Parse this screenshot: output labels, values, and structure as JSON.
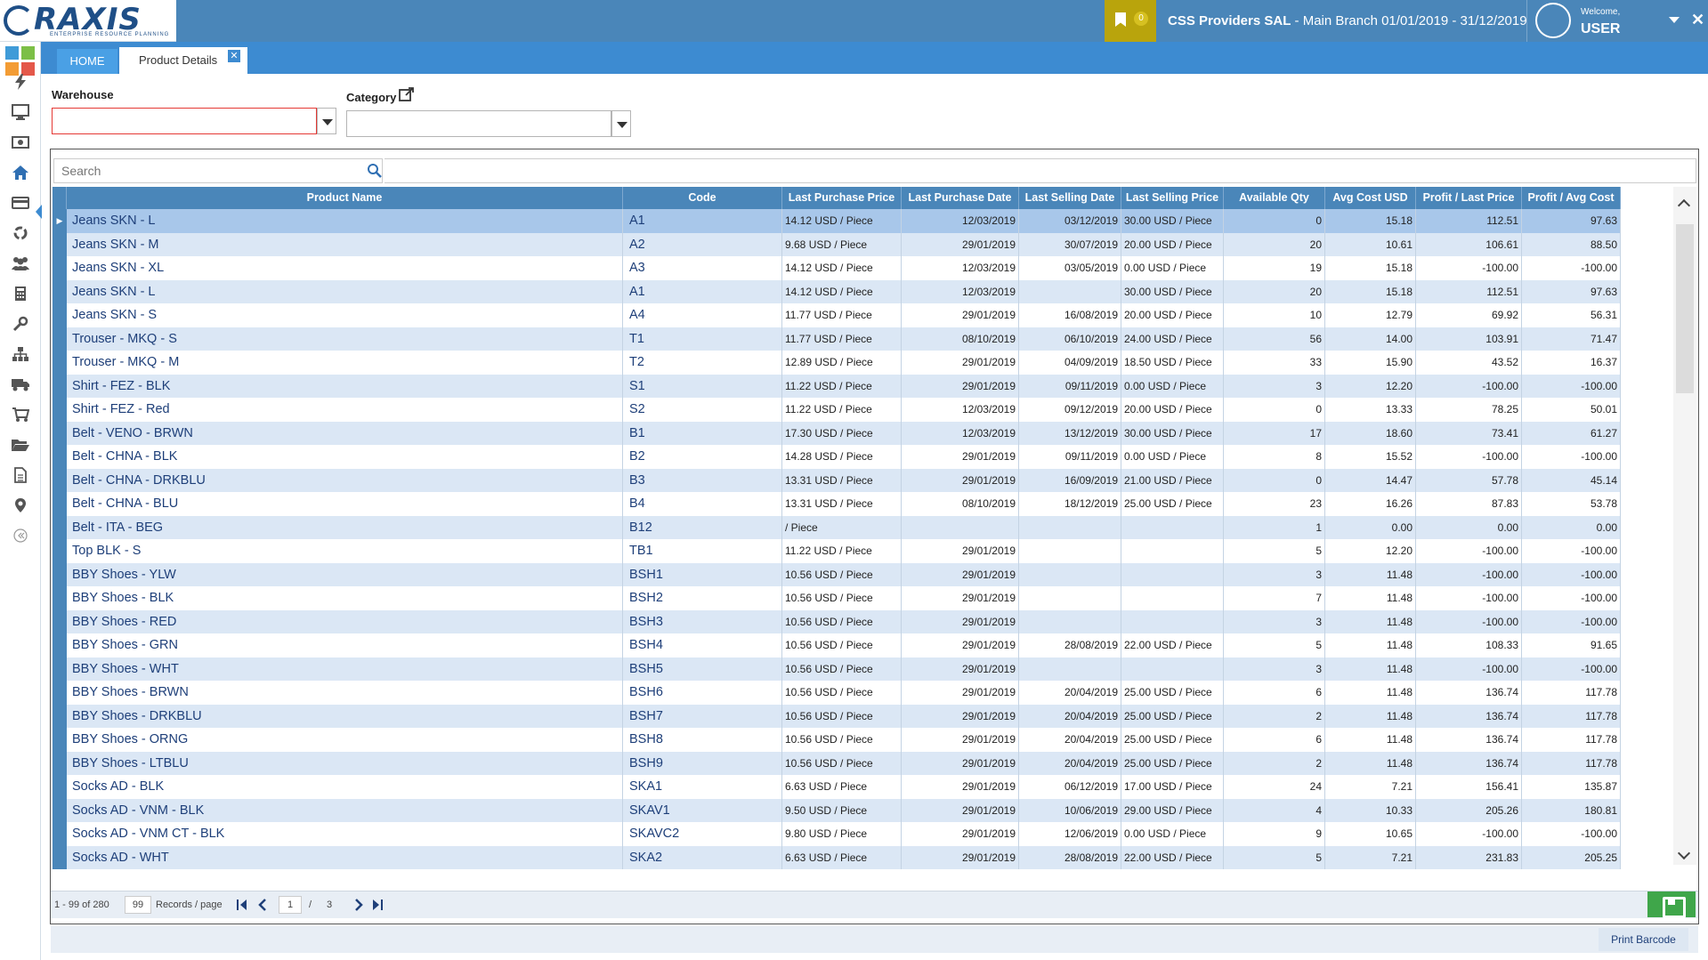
{
  "header": {
    "logo_text": "RAXIS",
    "logo_subtitle": "ENTERPRISE RESOURCE PLANNING",
    "bookmark_count": "0",
    "company_name": "CSS Providers SAL",
    "company_branch": " - Main Branch 01/01/2019 - 31/12/2019",
    "welcome_label": "Welcome,",
    "user_name": "USER",
    "close_glyph": "✕"
  },
  "tabs": {
    "home_label": "HOME",
    "active_label": "Product Details",
    "close_glyph": "✕"
  },
  "filters": {
    "warehouse_label": "Warehouse",
    "warehouse_value": "",
    "category_label": "Category",
    "category_value": ""
  },
  "search": {
    "placeholder": "Search"
  },
  "grid": {
    "columns": [
      "Product Name",
      "Code",
      "Last Purchase Price",
      "Last Purchase Date",
      "Last Selling Date",
      "Last Selling Price",
      "Available Qty",
      "Avg Cost USD",
      "Profit / Last Price",
      "Profit / Avg Cost"
    ],
    "selected_indicator": "▶",
    "rows": [
      [
        "Jeans SKN - L",
        "A1",
        "14.12 USD / Piece",
        "12/03/2019",
        "03/12/2019",
        "30.00 USD / Piece",
        "0",
        "15.18",
        "112.51",
        "97.63"
      ],
      [
        "Jeans SKN  - M",
        "A2",
        "9.68 USD / Piece",
        "29/01/2019",
        "30/07/2019",
        "20.00 USD / Piece",
        "20",
        "10.61",
        "106.61",
        "88.50"
      ],
      [
        "Jeans SKN - XL",
        "A3",
        "14.12 USD / Piece",
        "12/03/2019",
        "03/05/2019",
        "0.00 USD / Piece",
        "19",
        "15.18",
        "-100.00",
        "-100.00"
      ],
      [
        "Jeans SKN - L",
        "A1",
        "14.12 USD / Piece",
        "12/03/2019",
        "",
        "30.00 USD / Piece",
        "20",
        "15.18",
        "112.51",
        "97.63"
      ],
      [
        "Jeans SKN - S",
        "A4",
        "11.77 USD / Piece",
        "29/01/2019",
        "16/08/2019",
        "20.00 USD / Piece",
        "10",
        "12.79",
        "69.92",
        "56.31"
      ],
      [
        "Trouser - MKQ - S",
        "T1",
        "11.77 USD / Piece",
        "08/10/2019",
        "06/10/2019",
        "24.00 USD / Piece",
        "56",
        "14.00",
        "103.91",
        "71.47"
      ],
      [
        "Trouser - MKQ - M",
        "T2",
        "12.89 USD / Piece",
        "29/01/2019",
        "04/09/2019",
        "18.50 USD / Piece",
        "33",
        "15.90",
        "43.52",
        "16.37"
      ],
      [
        "Shirt - FEZ - BLK",
        "S1",
        "11.22 USD / Piece",
        "29/01/2019",
        "09/11/2019",
        "0.00 USD / Piece",
        "3",
        "12.20",
        "-100.00",
        "-100.00"
      ],
      [
        "Shirt - FEZ - Red",
        "S2",
        "11.22 USD / Piece",
        "12/03/2019",
        "09/12/2019",
        "20.00 USD / Piece",
        "0",
        "13.33",
        "78.25",
        "50.01"
      ],
      [
        "Belt - VENO - BRWN",
        "B1",
        "17.30 USD / Piece",
        "12/03/2019",
        "13/12/2019",
        "30.00 USD / Piece",
        "17",
        "18.60",
        "73.41",
        "61.27"
      ],
      [
        "Belt - CHNA - BLK",
        "B2",
        "14.28 USD / Piece",
        "29/01/2019",
        "09/11/2019",
        "0.00 USD / Piece",
        "8",
        "15.52",
        "-100.00",
        "-100.00"
      ],
      [
        "Belt - CHNA - DRKBLU",
        "B3",
        "13.31 USD / Piece",
        "29/01/2019",
        "16/09/2019",
        "21.00 USD / Piece",
        "0",
        "14.47",
        "57.78",
        "45.14"
      ],
      [
        "Belt - CHNA - BLU",
        "B4",
        "13.31 USD / Piece",
        "08/10/2019",
        "18/12/2019",
        "25.00 USD / Piece",
        "23",
        "16.26",
        "87.83",
        "53.78"
      ],
      [
        "Belt - ITA - BEG",
        "B12",
        " / Piece",
        "",
        "",
        "",
        "1",
        "0.00",
        "0.00",
        "0.00"
      ],
      [
        "Top BLK - S",
        "TB1",
        "11.22 USD / Piece",
        "29/01/2019",
        "",
        "",
        "5",
        "12.20",
        "-100.00",
        "-100.00"
      ],
      [
        "BBY Shoes - YLW",
        "BSH1",
        "10.56 USD / Piece",
        "29/01/2019",
        "",
        "",
        "3",
        "11.48",
        "-100.00",
        "-100.00"
      ],
      [
        "BBY Shoes - BLK",
        "BSH2",
        "10.56 USD / Piece",
        "29/01/2019",
        "",
        "",
        "7",
        "11.48",
        "-100.00",
        "-100.00"
      ],
      [
        "BBY Shoes - RED",
        "BSH3",
        "10.56 USD / Piece",
        "29/01/2019",
        "",
        "",
        "3",
        "11.48",
        "-100.00",
        "-100.00"
      ],
      [
        "BBY Shoes - GRN",
        "BSH4",
        "10.56 USD / Piece",
        "29/01/2019",
        "28/08/2019",
        "22.00 USD / Piece",
        "5",
        "11.48",
        "108.33",
        "91.65"
      ],
      [
        "BBY Shoes - WHT",
        "BSH5",
        "10.56 USD / Piece",
        "29/01/2019",
        "",
        "",
        "3",
        "11.48",
        "-100.00",
        "-100.00"
      ],
      [
        "BBY Shoes - BRWN",
        "BSH6",
        "10.56 USD / Piece",
        "29/01/2019",
        "20/04/2019",
        "25.00 USD / Piece",
        "6",
        "11.48",
        "136.74",
        "117.78"
      ],
      [
        "BBY Shoes - DRKBLU",
        "BSH7",
        "10.56 USD / Piece",
        "29/01/2019",
        "20/04/2019",
        "25.00 USD / Piece",
        "2",
        "11.48",
        "136.74",
        "117.78"
      ],
      [
        "BBY Shoes - ORNG",
        "BSH8",
        "10.56 USD / Piece",
        "29/01/2019",
        "20/04/2019",
        "25.00 USD / Piece",
        "6",
        "11.48",
        "136.74",
        "117.78"
      ],
      [
        "BBY Shoes - LTBLU",
        "BSH9",
        "10.56 USD / Piece",
        "29/01/2019",
        "20/04/2019",
        "25.00 USD / Piece",
        "2",
        "11.48",
        "136.74",
        "117.78"
      ],
      [
        "Socks AD - BLK",
        "SKA1",
        "6.63 USD / Piece",
        "29/01/2019",
        "06/12/2019",
        "17.00 USD / Piece",
        "24",
        "7.21",
        "156.41",
        "135.87"
      ],
      [
        "Socks AD - VNM - BLK",
        "SKAV1",
        "9.50 USD / Piece",
        "29/01/2019",
        "10/06/2019",
        "29.00 USD / Piece",
        "4",
        "10.33",
        "205.26",
        "180.81"
      ],
      [
        "Socks AD - VNM CT - BLK",
        "SKAVC2",
        "9.80 USD / Piece",
        "29/01/2019",
        "12/06/2019",
        "0.00 USD / Piece",
        "9",
        "10.65",
        "-100.00",
        "-100.00"
      ],
      [
        "Socks AD - WHT",
        "SKA2",
        "6.63 USD / Piece",
        "29/01/2019",
        "28/08/2019",
        "22.00 USD / Piece",
        "5",
        "7.21",
        "231.83",
        "205.25"
      ]
    ]
  },
  "pager": {
    "range_text": "1 - 99 of 280",
    "page_size": "99",
    "records_label": "Records / page",
    "current_page": "1",
    "page_sep": "/",
    "total_pages": "3"
  },
  "footer": {
    "print_barcode_label": "Print Barcode"
  },
  "colors": {
    "header_blue": "#4a86b9",
    "tab_blue": "#3d8bd1",
    "bookmark_gold": "#b9a40c",
    "save_green": "#3fa64a",
    "row_alt": "#dbe7f5",
    "row_selected": "#a8c7ea",
    "error_red": "#e53935"
  },
  "sidebar_icons": [
    "apps-grid-icon",
    "flash-icon",
    "monitor-icon",
    "money-icon",
    "home-icon",
    "credit-card-icon",
    "recycle-icon",
    "users-icon",
    "calculator-icon",
    "wrench-icon",
    "sitemap-icon",
    "truck-icon",
    "cart-icon",
    "folder-icon",
    "document-icon",
    "map-marker-icon",
    "collapse-icon"
  ]
}
